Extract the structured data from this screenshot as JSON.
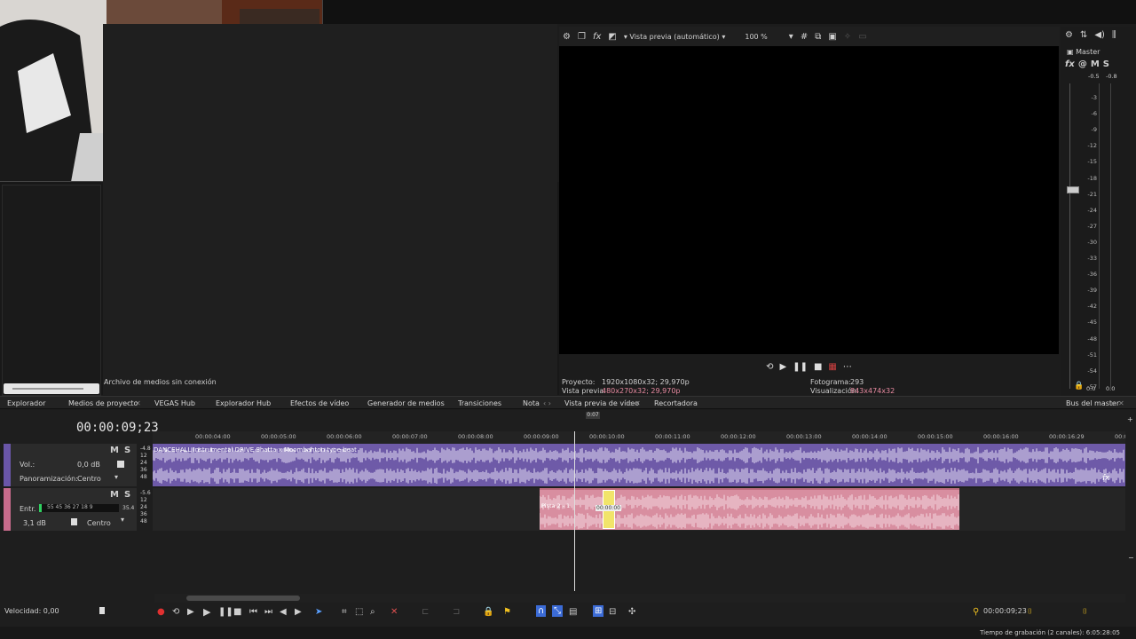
{
  "preview": {
    "mode_label": "Vista previa (automático)",
    "zoom": "100 %",
    "info_project_label": "Proyecto:",
    "info_project_value": "1920x1080x32; 29,970p",
    "info_preview_label": "Vista previa:",
    "info_preview_value": "480x270x32; 29,970p",
    "info_frame_label": "Fotograma:",
    "info_frame_value": "293",
    "info_display_label": "Visualización:",
    "info_display_value": "843x474x32"
  },
  "master": {
    "title": "Master",
    "top_left": "-0.5",
    "top_right": "-0.8",
    "bottom_left": "0.0",
    "bottom_right": "0.0",
    "ticks": [
      "3",
      "6",
      "9",
      "12",
      "15",
      "18",
      "21",
      "24",
      "27",
      "30",
      "33",
      "36",
      "39",
      "42",
      "45",
      "48",
      "51",
      "54",
      "57"
    ]
  },
  "media": {
    "offline_label": "Archivo de medios sin conexión"
  },
  "tabs": [
    "Explorador",
    "Medios de proyecto",
    "VEGAS Hub",
    "Explorador Hub",
    "Efectos de vídeo",
    "Generador de medios",
    "Transiciones",
    "Nota",
    "Vista previa de vídeo",
    "Recortadora",
    "Bus del master"
  ],
  "timeline": {
    "timecode": "00:00:09;23",
    "cursor_marker": "0:07",
    "ruler": [
      "00:00:04:00",
      "00:00:05:00",
      "00:00:06:00",
      "00:00:07:00",
      "00:00:08:00",
      "00:00:09:00",
      "00:00:10:00",
      "00:00:11:00",
      "00:00:12:00",
      "00:00:13:00",
      "00:00:14:00",
      "00:00:15:00",
      "00:00:16:00",
      "00:00:16:29",
      "00:00"
    ],
    "track1": {
      "vol_label": "Vol.:",
      "vol_value": "0,0 dB",
      "pan_label": "Panoramización:",
      "pan_value": "Centro",
      "clip_title": "DANCEHALL Instrumental  DRIVE Shatta x Moombahton type beat",
      "meter_levels": [
        "-4.8",
        "12",
        "24",
        "36",
        "48"
      ]
    },
    "track2": {
      "input_label": "Entr.",
      "meter_scale": "55  45  36  27  18  9",
      "peak": "35.4",
      "gain": "3,1 dB",
      "pan_value": "Centro",
      "clip_label": "Pista 2 - 1",
      "meter_levels": [
        "-5.6",
        "12",
        "24",
        "36",
        "48"
      ],
      "clip_tag": "00:00:00"
    }
  },
  "bottom": {
    "speed_label": "Velocidad: 0,00",
    "timecode": "00:00:09;23",
    "status": "Tiempo de grabación (2 canales): 6:05:28:05"
  },
  "colors": {
    "track1": "#6e5aa8",
    "track2_clip": "#d88ea0",
    "record": "#e03030"
  }
}
